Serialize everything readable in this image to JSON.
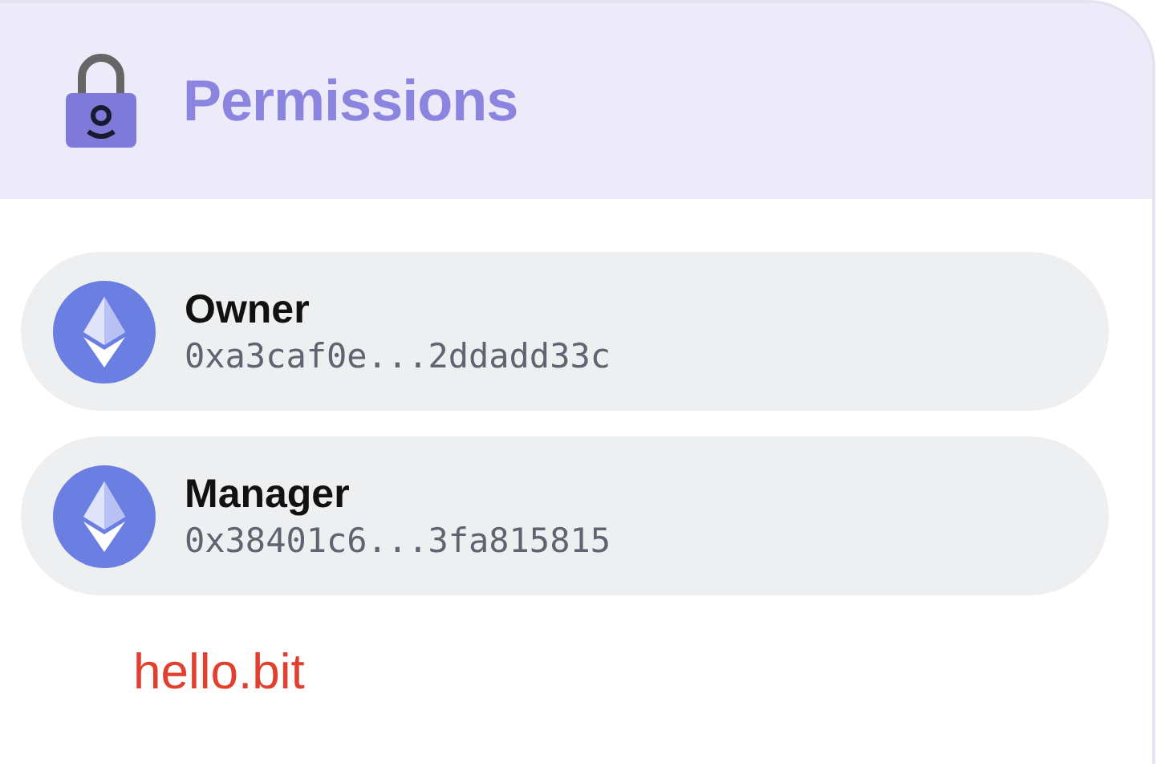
{
  "header": {
    "title": "Permissions"
  },
  "permissions": [
    {
      "role": "Owner",
      "address": "0xa3caf0e...2ddadd33c"
    },
    {
      "role": "Manager",
      "address": "0x38401c6...3fa815815"
    }
  ],
  "domain": "hello.bit"
}
